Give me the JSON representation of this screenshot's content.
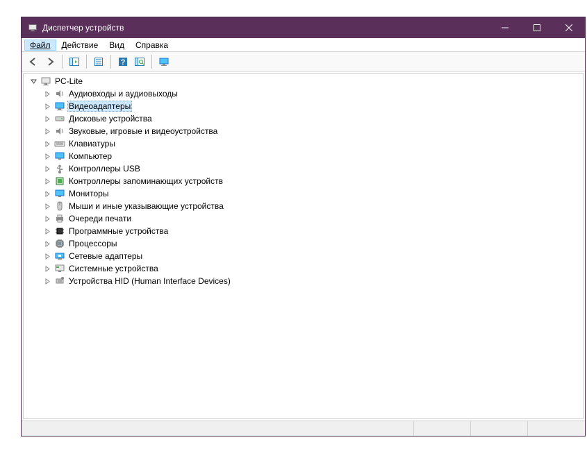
{
  "window": {
    "title": "Диспетчер устройств"
  },
  "menu": {
    "file": "Файл",
    "action": "Действие",
    "view": "Вид",
    "help": "Справка"
  },
  "tree": {
    "root": "PC-Lite",
    "items": [
      {
        "label": "Аудиовходы и аудиовыходы",
        "icon": "audio"
      },
      {
        "label": "Видеоадаптеры",
        "icon": "display",
        "selected": true
      },
      {
        "label": "Дисковые устройства",
        "icon": "disk"
      },
      {
        "label": "Звуковые, игровые и видеоустройства",
        "icon": "audio"
      },
      {
        "label": "Клавиатуры",
        "icon": "keyboard"
      },
      {
        "label": "Компьютер",
        "icon": "monitor"
      },
      {
        "label": "Контроллеры USB",
        "icon": "usb"
      },
      {
        "label": "Контроллеры запоминающих устройств",
        "icon": "storage"
      },
      {
        "label": "Мониторы",
        "icon": "monitor"
      },
      {
        "label": "Мыши и иные указывающие устройства",
        "icon": "mouse"
      },
      {
        "label": "Очереди печати",
        "icon": "printer"
      },
      {
        "label": "Программные устройства",
        "icon": "chip"
      },
      {
        "label": "Процессоры",
        "icon": "cpu"
      },
      {
        "label": "Сетевые адаптеры",
        "icon": "network"
      },
      {
        "label": "Системные устройства",
        "icon": "system"
      },
      {
        "label": "Устройства HID (Human Interface Devices)",
        "icon": "hid"
      }
    ]
  }
}
